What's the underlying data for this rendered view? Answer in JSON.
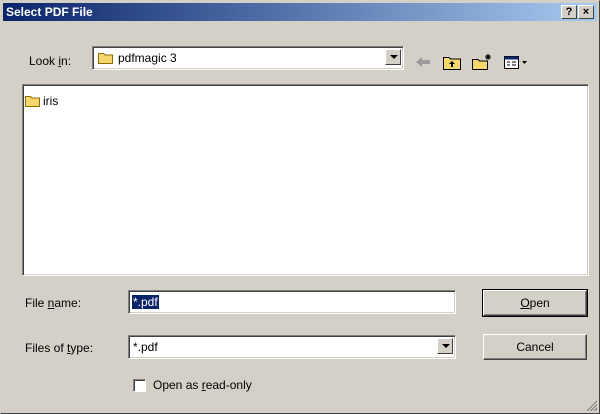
{
  "window": {
    "title": "Select PDF File",
    "help_label": "?",
    "close_label": "×"
  },
  "lookin": {
    "label_pre": "Look ",
    "label_u": "i",
    "label_post": "n:",
    "value": "pdfmagic 3"
  },
  "toolbar": {
    "back_icon": "back-arrow-icon",
    "up_icon": "up-folder-icon",
    "new_folder_icon": "new-folder-icon",
    "view_icon": "view-menu-icon"
  },
  "files": [
    {
      "name": "iris",
      "type": "folder"
    }
  ],
  "filename": {
    "label_pre": "File ",
    "label_u": "n",
    "label_post": "ame:",
    "value": "*.pdf"
  },
  "filetype": {
    "label_pre": "Files of ",
    "label_u": "t",
    "label_post": "ype:",
    "value": "*.pdf"
  },
  "buttons": {
    "open_u": "O",
    "open_rest": "pen",
    "cancel": "Cancel"
  },
  "readonly": {
    "label_pre": "Open as ",
    "label_u": "r",
    "label_post": "ead-only",
    "checked": false
  },
  "colors": {
    "title_start": "#0a246a",
    "title_end": "#a6caf0",
    "face": "#d4d0c8",
    "folder": "#f5d76e"
  }
}
